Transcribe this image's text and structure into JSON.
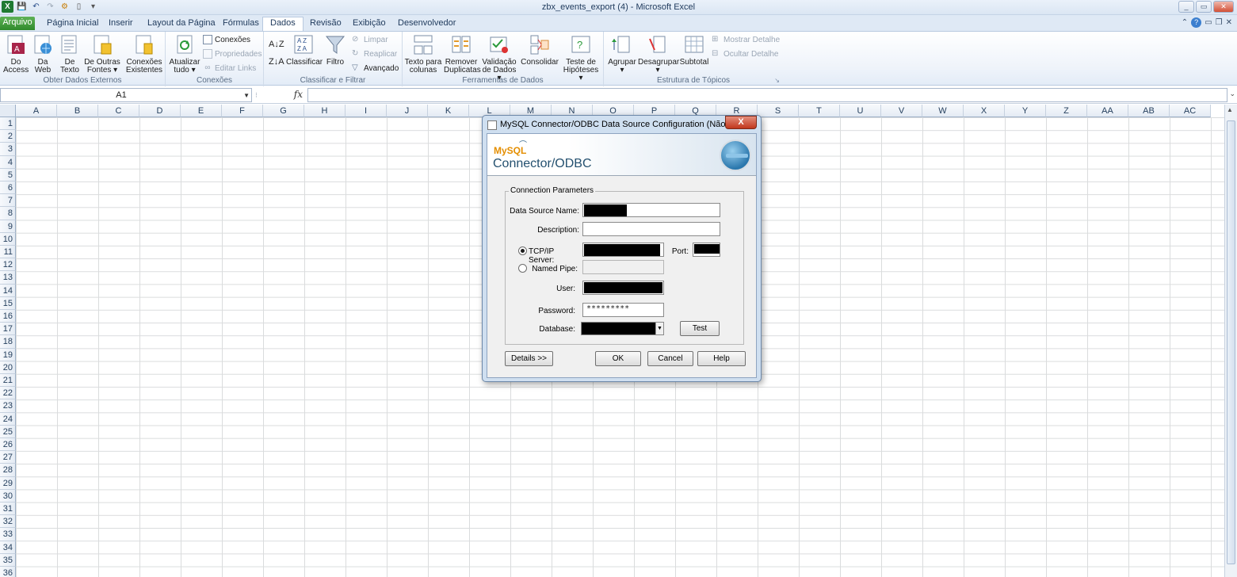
{
  "window": {
    "title": "zbx_events_export (4)  -  Microsoft Excel",
    "controls": [
      "_",
      "▭",
      "✕"
    ]
  },
  "tabs": [
    {
      "label": "Arquivo"
    },
    {
      "label": "Página Inicial"
    },
    {
      "label": "Inserir"
    },
    {
      "label": "Layout da Página"
    },
    {
      "label": "Fórmulas"
    },
    {
      "label": "Dados"
    },
    {
      "label": "Revisão"
    },
    {
      "label": "Exibição"
    },
    {
      "label": "Desenvolvedor"
    }
  ],
  "ribbon": {
    "groups": {
      "external": "Obter Dados Externos",
      "connections": "Conexões",
      "sort_filter": "Classificar e Filtrar",
      "data_tools": "Ferramentas de Dados",
      "outline": "Estrutura de Tópicos"
    },
    "buttons": {
      "access": [
        "Do",
        "Access"
      ],
      "web": [
        "Da",
        "Web"
      ],
      "text": [
        "De",
        "Texto"
      ],
      "other": [
        "De Outras",
        "Fontes ▾"
      ],
      "existing": [
        "Conexões",
        "Existentes"
      ],
      "refresh": [
        "Atualizar",
        "tudo ▾"
      ],
      "connections": "Conexões",
      "properties": "Propriedades",
      "edit_links": "Editar Links",
      "sort": "Classificar",
      "filter": "Filtro",
      "clear": "Limpar",
      "reapply": "Reaplicar",
      "advanced": "Avançado",
      "text_to_cols": [
        "Texto para",
        "colunas"
      ],
      "remove_dup": [
        "Remover",
        "Duplicatas"
      ],
      "validation": [
        "Validação",
        "de Dados ▾"
      ],
      "consolidate": "Consolidar",
      "whatif": [
        "Teste de",
        "Hipóteses ▾"
      ],
      "group": "Agrupar",
      "ungroup": "Desagrupar",
      "subtotal": "Subtotal",
      "show_detail": "Mostrar Detalhe",
      "hide_detail": "Ocultar Detalhe"
    }
  },
  "formula_bar": {
    "name_box": "A1",
    "fx": "fx",
    "formula": ""
  },
  "columns": [
    "A",
    "B",
    "C",
    "D",
    "E",
    "F",
    "G",
    "H",
    "I",
    "J",
    "K",
    "L",
    "M",
    "N",
    "O",
    "P",
    "Q",
    "R",
    "S",
    "T",
    "U",
    "V",
    "W",
    "X",
    "Y",
    "Z",
    "AA",
    "AB",
    "AC"
  ],
  "rows": [
    "1",
    "2",
    "3",
    "4",
    "5",
    "6",
    "7",
    "8",
    "9",
    "10",
    "11",
    "12",
    "13",
    "14",
    "15",
    "16",
    "17",
    "18",
    "19",
    "20",
    "21",
    "22",
    "23",
    "24",
    "25",
    "26",
    "27",
    "28",
    "29",
    "30",
    "31",
    "32",
    "33",
    "34",
    "35",
    "36"
  ],
  "dialog": {
    "title": "MySQL Connector/ODBC Data Source Configuration (Não está r...",
    "close": "X",
    "logo_mysql": "MySQL",
    "logo_connector": "Connector/ODBC",
    "group_label": "Connection Parameters",
    "labels": {
      "dsn": "Data Source Name:",
      "description": "Description:",
      "tcpip": "TCP/IP Server:",
      "port": "Port:",
      "named_pipe": "Named Pipe:",
      "user": "User:",
      "password": "Password:",
      "database": "Database:"
    },
    "values": {
      "password": "*********",
      "connection_type": "TCP/IP Server"
    },
    "buttons": {
      "test": "Test",
      "details": "Details >>",
      "ok": "OK",
      "cancel": "Cancel",
      "help": "Help"
    }
  }
}
